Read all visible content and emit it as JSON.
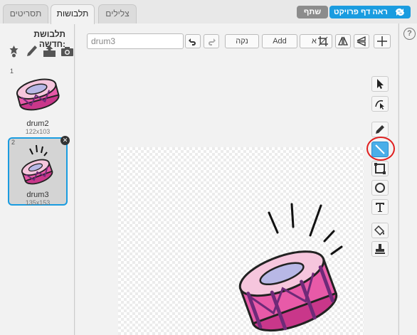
{
  "tabs": {
    "scripts": "תסריטים",
    "costumes": "תלבושות",
    "sounds": "צלילים"
  },
  "header": {
    "share_label": "שתף",
    "see_project_label": "ראה דף פרויקט"
  },
  "costumes_pane": {
    "new_costume_label": "תלבושת חדשה:",
    "items": [
      {
        "index": "1",
        "name": "drum2",
        "size": "122x103"
      },
      {
        "index": "2",
        "name": "drum3",
        "size": "135x153"
      }
    ]
  },
  "editor": {
    "costume_name_value": "drum3",
    "clear_label": "נקה",
    "add_label": "Add",
    "import_label": "א"
  },
  "tools": {
    "active": "line-tool"
  },
  "colors": {
    "accent": "#1a9ce0",
    "highlight": "#e01e1e",
    "drum_pink": "#e85aa8",
    "drum_purple": "#6e2a78"
  }
}
